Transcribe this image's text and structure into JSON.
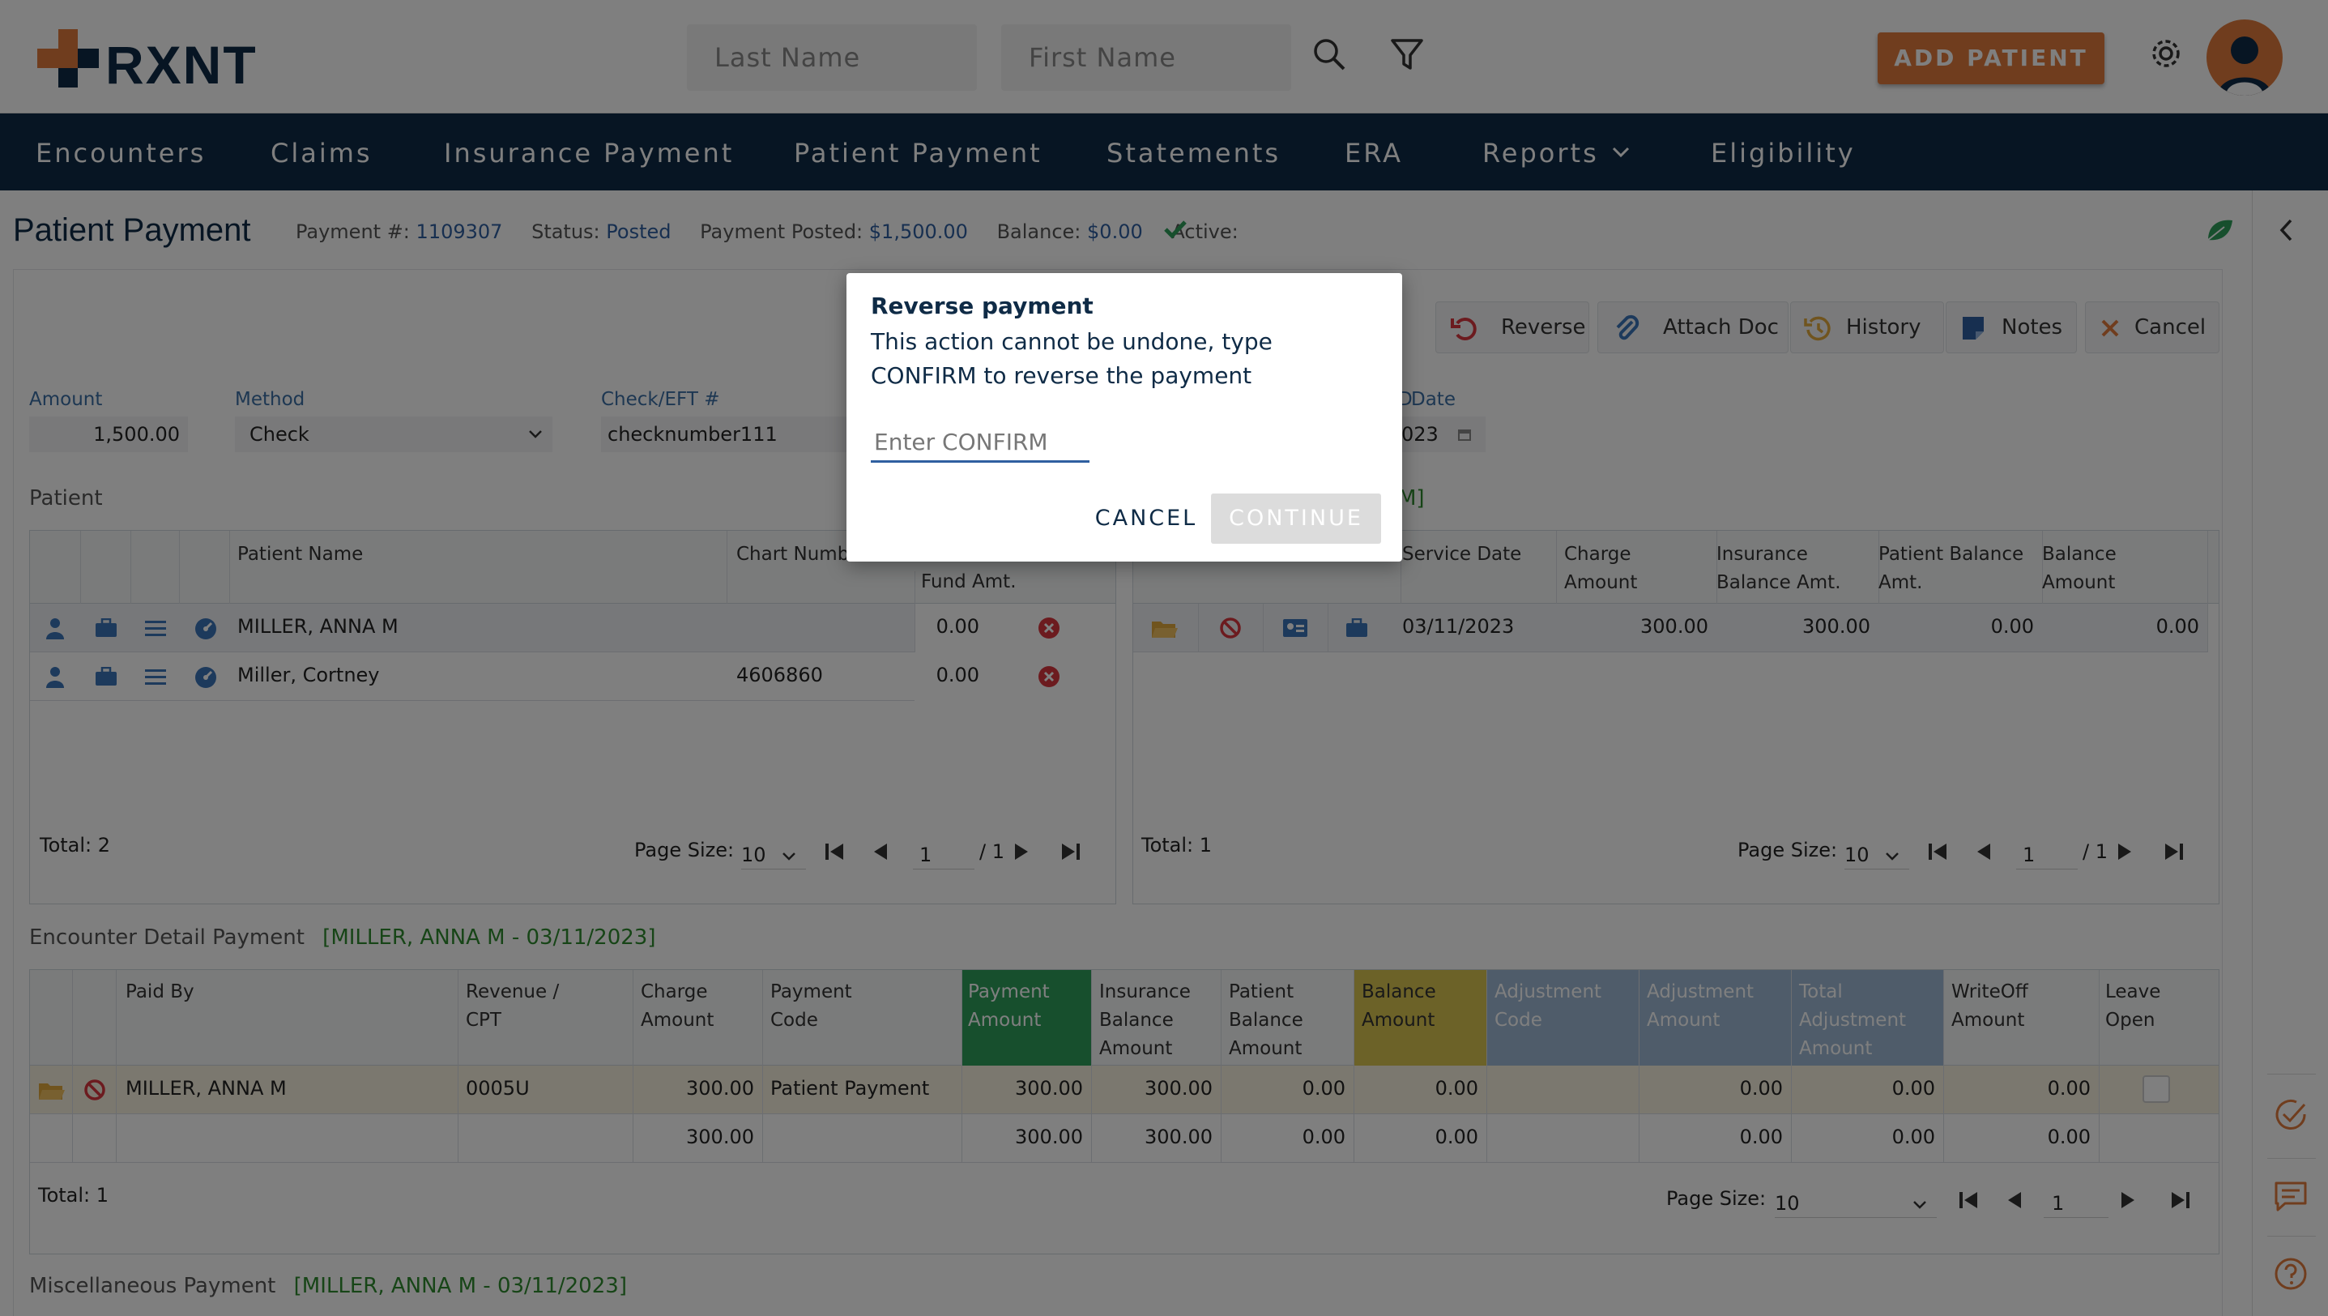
{
  "header": {
    "logo_text": "RXNT",
    "last_name_placeholder": "Last Name",
    "first_name_placeholder": "First Name",
    "add_patient": "ADD PATIENT"
  },
  "nav": {
    "items": [
      "Encounters",
      "Claims",
      "Insurance Payment",
      "Patient Payment",
      "Statements",
      "ERA",
      "Reports",
      "Eligibility"
    ]
  },
  "page": {
    "title": "Patient Payment",
    "payment_no_label": "Payment #:",
    "payment_no": "1109307",
    "status_label": "Status:",
    "status": "Posted",
    "posted_label": "Payment Posted:",
    "posted": "$1,500.00",
    "balance_label": "Balance:",
    "balance": "$0.00",
    "active_label": "Active:"
  },
  "actions": [
    "Reverse",
    "Attach Doc",
    "History",
    "Notes",
    "Cancel"
  ],
  "form": {
    "amount_label": "Amount",
    "amount": "1,500.00",
    "method_label": "Method",
    "method": "Check",
    "check_label": "Check/EFT #",
    "check": "checknumber111",
    "date_label": "Date",
    "date_partial": "023",
    "date_label_prefix": "D"
  },
  "patient_table": {
    "section": "Patient",
    "headers": [
      "Patient Name",
      "Chart Numb",
      "Fund Amt."
    ],
    "rows": [
      {
        "name": "MILLER, ANNA M",
        "chart": "",
        "fund": "0.00"
      },
      {
        "name": "Miller, Cortney",
        "chart": "4606860",
        "fund": "0.00"
      }
    ],
    "total": "Total: 2",
    "page_size_label": "Page Size:",
    "page_size": "10",
    "page": "1",
    "pages": "/ 1"
  },
  "encounter_table": {
    "section_partial": "M]",
    "headers": [
      "Service Date",
      "Charge Amount",
      "Insurance Balance Amt.",
      "Patient Balance Amt.",
      "Balance Amount"
    ],
    "rows": [
      {
        "date": "03/11/2023",
        "charge": "300.00",
        "ins": "300.00",
        "pat": "0.00",
        "bal": "0.00"
      }
    ],
    "total": "Total: 1",
    "page_size_label": "Page Size:",
    "page_size": "10",
    "page": "1",
    "pages": "/ 1"
  },
  "detail": {
    "section": "Encounter Detail Payment",
    "context": "[MILLER, ANNA M - 03/11/2023]",
    "headers": [
      "Paid By",
      "Revenue / CPT",
      "Charge Amount",
      "Payment Code",
      "Payment Amount",
      "Insurance Balance Amount",
      "Patient Balance Amount",
      "Balance Amount",
      "Adjustment Code",
      "Adjustment Amount",
      "Total Adjustment Amount",
      "WriteOff Amount",
      "Leave Open"
    ],
    "row": {
      "paid_by": "MILLER, ANNA M",
      "cpt": "0005U",
      "charge": "300.00",
      "code": "Patient Payment",
      "payment": "300.00",
      "ins": "300.00",
      "pat": "0.00",
      "bal": "0.00",
      "adj_code": "",
      "adj": "0.00",
      "total_adj": "0.00",
      "writeoff": "0.00"
    },
    "totals": {
      "charge": "300.00",
      "payment": "300.00",
      "ins": "300.00",
      "pat": "0.00",
      "bal": "0.00",
      "adj": "0.00",
      "total_adj": "0.00",
      "writeoff": "0.00"
    },
    "total": "Total: 1",
    "page_size_label": "Page Size:",
    "page_size": "10",
    "page": "1"
  },
  "misc": {
    "section": "Miscellaneous Payment",
    "context": "[MILLER, ANNA M - 03/11/2023]"
  },
  "modal": {
    "title": "Reverse payment",
    "message": "This action cannot be undone, type CONFIRM to reverse the payment",
    "placeholder": "Enter CONFIRM",
    "cancel": "CANCEL",
    "continue": "CONTINUE"
  },
  "colors": {
    "navy": "#0f2b46",
    "accent": "#e07b3c",
    "payment_green": "#2e9e5b",
    "balance_yellow": "#d9c451",
    "adjust_blue": "#9eb8d4"
  }
}
